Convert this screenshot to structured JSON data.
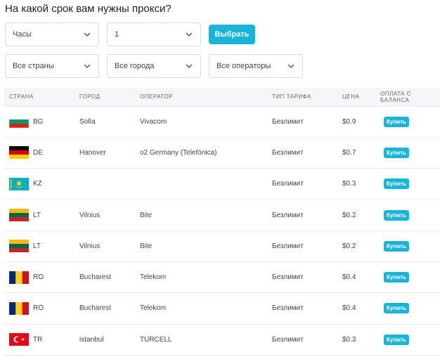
{
  "title": "На какой срок вам нужны прокси?",
  "filters": {
    "duration": "Часы",
    "quantity": "1",
    "select_button": "Выбрать",
    "country": "Все страны",
    "city": "Все города",
    "operator": "Все операторы"
  },
  "table": {
    "headers": [
      "СТРАНА",
      "ГОРОД",
      "ОПЕРАТОР",
      "ТИП ТАРИФА",
      "ЦЕНА",
      "ОПЛАТА С БАЛАНСА"
    ],
    "buy_label": "Купить",
    "rows": [
      {
        "code": "BG",
        "city": "Sofia",
        "operator": "Vivacom",
        "tariff": "Безлимит",
        "price": "$0.9"
      },
      {
        "code": "DE",
        "city": "Hanover",
        "operator": "o2 Germany (Telefónica)",
        "tariff": "Безлимит",
        "price": "$0.7"
      },
      {
        "code": "KZ",
        "city": "",
        "operator": "",
        "tariff": "Безлимит",
        "price": "$0.3"
      },
      {
        "code": "LT",
        "city": "Vilnius",
        "operator": "Bite",
        "tariff": "Безлимит",
        "price": "$0.2"
      },
      {
        "code": "LT",
        "city": "Vilnius",
        "operator": "Bite",
        "tariff": "Безлимит",
        "price": "$0.2"
      },
      {
        "code": "RO",
        "city": "Bucharest",
        "operator": "Telekom",
        "tariff": "Безлимит",
        "price": "$0.4"
      },
      {
        "code": "RO",
        "city": "Bucharest",
        "operator": "Telekom",
        "tariff": "Безлимит",
        "price": "$0.4"
      },
      {
        "code": "TR",
        "city": "istanbul",
        "operator": "TURCELL",
        "tariff": "Безлимит",
        "price": "$0.3"
      }
    ]
  },
  "colors": {
    "accent": "#19b5d9"
  }
}
